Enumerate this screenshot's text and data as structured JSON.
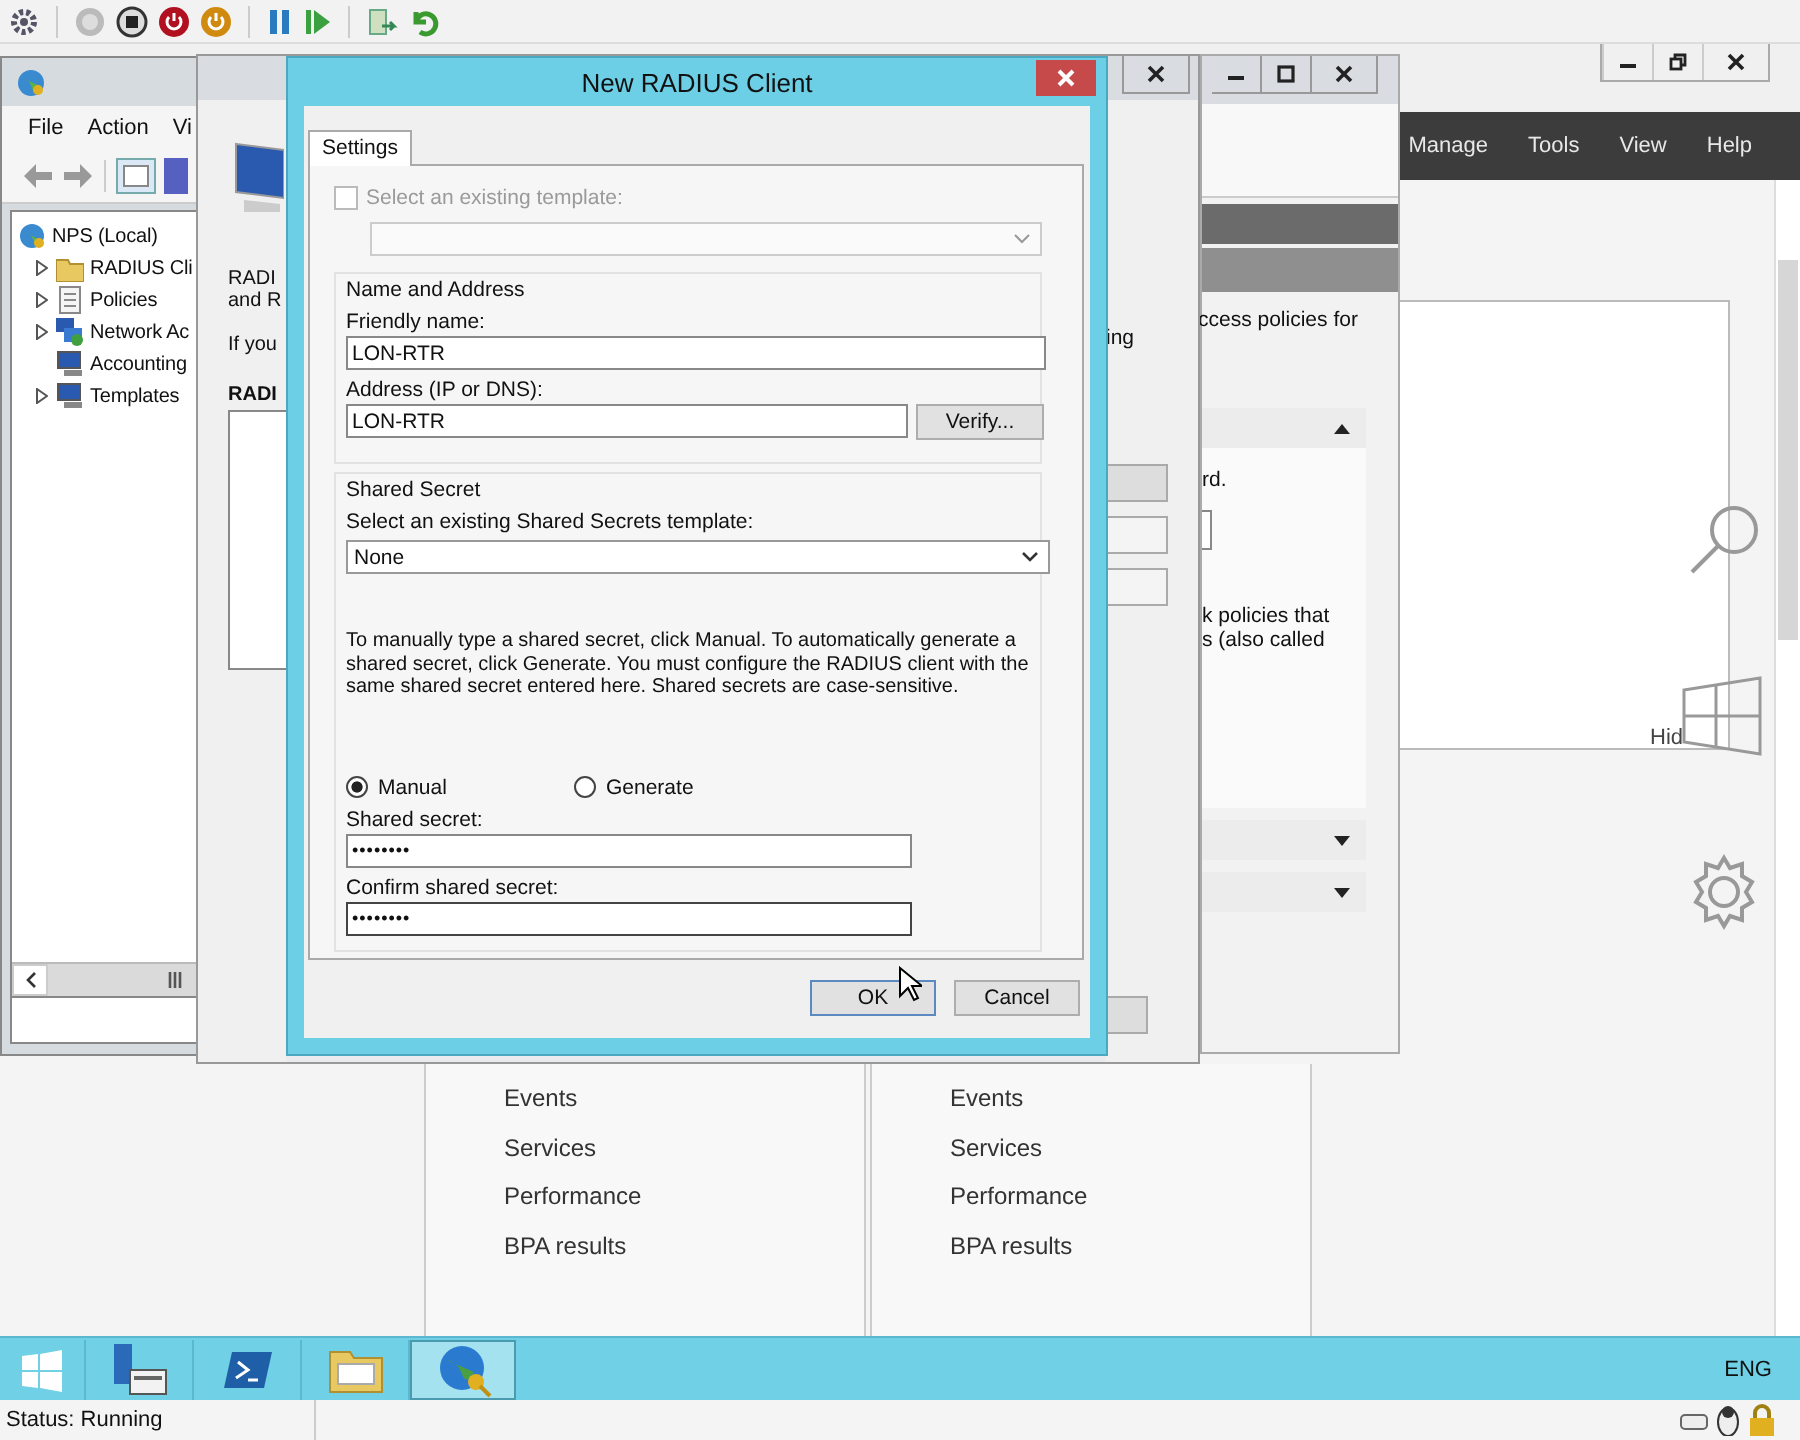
{
  "mmc": {
    "menu": [
      "File",
      "Action",
      "Vi"
    ],
    "tree": [
      {
        "label": "NPS (Local)",
        "children": [
          {
            "label": "RADIUS Cli",
            "expandable": true
          },
          {
            "label": "Policies",
            "expandable": true
          },
          {
            "label": "Network Ac",
            "expandable": true
          },
          {
            "label": "Accounting",
            "expandable": false
          },
          {
            "label": "Templates",
            "expandable": true
          }
        ]
      }
    ]
  },
  "wizard": {
    "lines_left": [
      "RADI",
      "and R",
      "If you"
    ],
    "heading_left": "RADI",
    "line_right": "ing"
  },
  "side_window": {
    "intro": "ccess policies for",
    "step_text": "rd.",
    "paragraph": [
      "k policies that",
      "s (also called"
    ],
    "sections": [
      {
        "expanded": true
      },
      {
        "expanded": false
      },
      {
        "expanded": false
      }
    ]
  },
  "server_manager": {
    "menu": [
      "Manage",
      "Tools",
      "View",
      "Help"
    ],
    "hide_label": "Hid",
    "tiles": [
      {
        "links": [
          "Events",
          "Services",
          "Performance",
          "BPA results"
        ]
      },
      {
        "links": [
          "Events",
          "Services",
          "Performance",
          "BPA results"
        ]
      }
    ]
  },
  "dialog": {
    "title": "New RADIUS Client",
    "tabs": [
      {
        "label": "Settings",
        "selected": true
      }
    ],
    "template": {
      "label": "Select an existing template:",
      "checked": false,
      "disabled": true
    },
    "name_group": {
      "title": "Name and Address",
      "friendly_label": "Friendly name:",
      "friendly_value": "LON-RTR",
      "address_label": "Address (IP or DNS):",
      "address_value": "LON-RTR",
      "verify_button": "Verify..."
    },
    "secret_group": {
      "title": "Shared Secret",
      "template_label": "Select an existing Shared Secrets template:",
      "template_value": "None",
      "description": "To manually type a shared secret, click Manual. To automatically generate a shared secret, click Generate. You must configure the RADIUS client with the same shared secret entered here. Shared secrets are case-sensitive.",
      "modes": [
        {
          "label": "Manual",
          "selected": true
        },
        {
          "label": "Generate",
          "selected": false
        }
      ],
      "secret_label": "Shared secret:",
      "secret_value": "••••••••",
      "confirm_label": "Confirm shared secret:",
      "confirm_value": "••••••••"
    },
    "buttons": [
      "OK",
      "Cancel"
    ]
  },
  "taskbar": {
    "apps": [
      {
        "selected": false
      },
      {
        "selected": false
      },
      {
        "selected": false
      },
      {
        "selected": false
      },
      {
        "selected": true
      }
    ],
    "language": "ENG"
  },
  "status_bar": {
    "text": "Status: Running"
  }
}
